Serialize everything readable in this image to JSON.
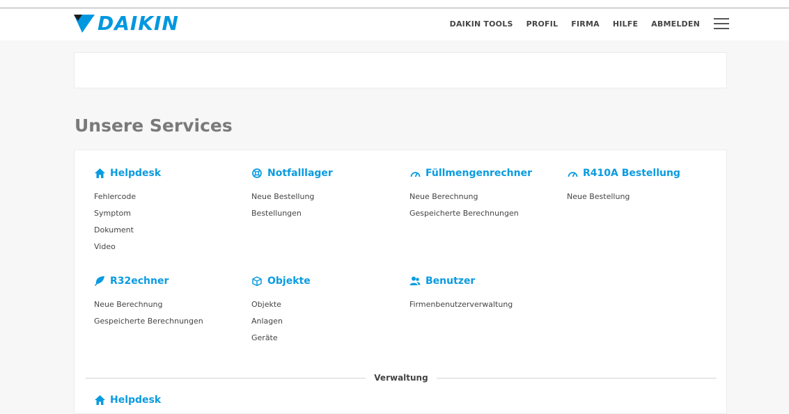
{
  "header": {
    "logo_text": "DAIKIN",
    "nav": [
      "DAIKIN TOOLS",
      "PROFIL",
      "FIRMA",
      "HILFE",
      "ABMELDEN"
    ]
  },
  "main": {
    "section_title": "Unsere Services",
    "groups": [
      {
        "title": "Helpdesk",
        "icon": "home-icon",
        "links": [
          "Fehlercode",
          "Symptom",
          "Dokument",
          "Video"
        ]
      },
      {
        "title": "Notfalllager",
        "icon": "lifebuoy-icon",
        "links": [
          "Neue Bestellung",
          "Bestellungen"
        ]
      },
      {
        "title": "Füllmengenrechner",
        "icon": "gauge-icon",
        "links": [
          "Neue Berechnung",
          "Gespeicherte Berechnungen"
        ]
      },
      {
        "title": "R410A Bestellung",
        "icon": "gauge-icon",
        "links": [
          "Neue Bestellung"
        ]
      },
      {
        "title": "R32echner",
        "icon": "leaf-icon",
        "links": [
          "Neue Berechnung",
          "Gespeicherte Berechnungen"
        ]
      },
      {
        "title": "Objekte",
        "icon": "cube-icon",
        "links": [
          "Objekte",
          "Anlagen",
          "Geräte"
        ]
      },
      {
        "title": "Benutzer",
        "icon": "users-icon",
        "links": [
          "Firmenbenutzerverwaltung"
        ]
      }
    ],
    "divider_label": "Verwaltung",
    "admin_group": {
      "title": "Helpdesk",
      "icon": "home-icon"
    }
  },
  "colors": {
    "brand": "#0097e0",
    "link_title": "#0a9be0",
    "background": "#f7f7f7"
  }
}
